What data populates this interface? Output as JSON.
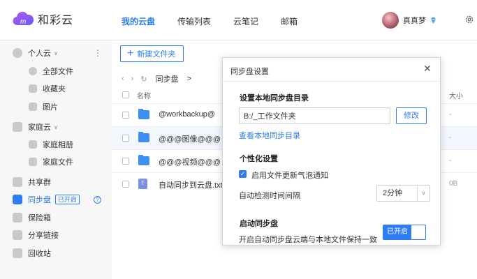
{
  "header": {
    "logo_text": "和彩云",
    "nav": [
      {
        "label": "我的云盘",
        "active": true
      },
      {
        "label": "传输列表",
        "active": false
      },
      {
        "label": "云笔记",
        "active": false
      },
      {
        "label": "邮箱",
        "active": false
      }
    ],
    "username": "真真梦"
  },
  "sidebar": {
    "personal_cloud": "个人云",
    "all_files": "全部文件",
    "favorites": "收藏夹",
    "photos": "图片",
    "family_cloud": "家庭云",
    "family_album": "家庭相册",
    "family_files": "家庭文件",
    "share_group": "共享群",
    "sync_disk": "同步盘",
    "sync_badge": "已开启",
    "safe_box": "保险箱",
    "share_link": "分享链接",
    "recycle_bin": "回收站"
  },
  "toolbar": {
    "new_folder": "新建文件夹"
  },
  "breadcrumb": {
    "path": "同步盘",
    "separator": ">"
  },
  "table": {
    "col_name": "名称",
    "col_size": "大小",
    "rows": [
      {
        "name": "@workbackup@",
        "size": "-",
        "type": "folder"
      },
      {
        "name": "@@@图像@@@",
        "size": "-",
        "type": "folder"
      },
      {
        "name": "@@@视频@@@",
        "size": "-",
        "type": "folder"
      },
      {
        "name": "自动同步到云盘.txt",
        "size": "0B",
        "type": "txt"
      }
    ]
  },
  "dialog": {
    "title": "同步盘设置",
    "close": "✕",
    "section_dir": "设置本地同步盘目录",
    "dir_value": "B:/_工作文件夹",
    "modify": "修改",
    "view_dir_link": "查看本地同步目录",
    "section_personal": "个性化设置",
    "bubble_notice": "启用文件更新气泡通知",
    "interval_label": "自动检测时间间隔",
    "interval_value": "2分钟",
    "section_sync": "启动同步盘",
    "sync_desc": "开启自动同步盘云端与本地文件保持一致",
    "toggle_label": "已开启"
  },
  "colors": {
    "accent": "#2d7cf3",
    "folder": "#3d8ff2"
  }
}
